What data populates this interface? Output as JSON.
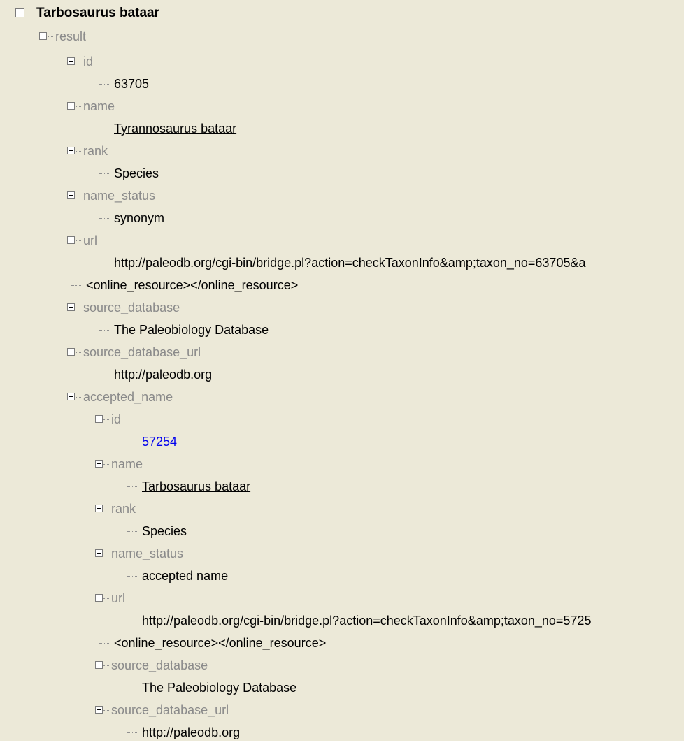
{
  "tree": {
    "root": "Tarbosaurus bataar",
    "result": "result",
    "fields": {
      "id": "id",
      "id_value": "63705",
      "name": "name",
      "name_value": "Tyrannosaurus bataar",
      "rank": "rank",
      "rank_value": "Species",
      "name_status": "name_status",
      "name_status_value": "synonym",
      "url": "url",
      "url_value": "http://paleodb.org/cgi-bin/bridge.pl?action=checkTaxonInfo&amp;taxon_no=63705&a",
      "online_resource": "<online_resource></online_resource>",
      "source_database": "source_database",
      "source_database_value": "The Paleobiology Database",
      "source_database_url": "source_database_url",
      "source_database_url_value": "http://paleodb.org"
    },
    "accepted_name": {
      "label": "accepted_name",
      "id": "id",
      "id_value": "57254",
      "name": "name",
      "name_value": "Tarbosaurus bataar",
      "rank": "rank",
      "rank_value": "Species",
      "name_status": "name_status",
      "name_status_value": "accepted name",
      "url": "url",
      "url_value": "http://paleodb.org/cgi-bin/bridge.pl?action=checkTaxonInfo&amp;taxon_no=5725",
      "online_resource": "<online_resource></online_resource>",
      "source_database": "source_database",
      "source_database_value": "The Paleobiology Database",
      "source_database_url": "source_database_url",
      "source_database_url_value": "http://paleodb.org"
    }
  },
  "colors": {
    "background": "#ece9d8",
    "key_text": "#8a8a8a",
    "value_text": "#000000",
    "link": "#0000ee",
    "tree_lines": "#909090"
  }
}
